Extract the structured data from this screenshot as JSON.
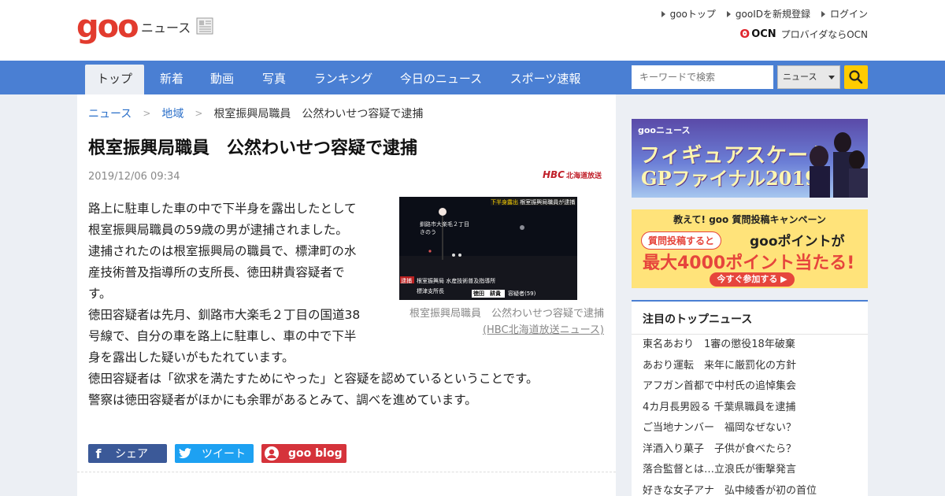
{
  "header": {
    "logo": "goo",
    "logo_sub": "ニュース",
    "top_links": [
      "gooトップ",
      "gooIDを新規登録",
      "ログイン"
    ],
    "ocn_brand": "OCN",
    "ocn_text": "プロバイダならOCN"
  },
  "nav": {
    "tabs": [
      "トップ",
      "新着",
      "動画",
      "写真",
      "ランキング",
      "今日のニュース",
      "スポーツ速報"
    ],
    "active": "トップ",
    "search_placeholder": "キーワードで検索",
    "search_scope": "ニュース"
  },
  "article": {
    "breadcrumb": [
      "ニュース",
      "地域",
      "根室振興局職員　公然わいせつ容疑で逮捕"
    ],
    "title": "根室振興局職員　公然わいせつ容疑で逮捕",
    "date": "2019/12/06 09:34",
    "source_logo": "HBC",
    "source_logo_sub": "北海道放送",
    "paragraphs": [
      "路上に駐車した車の中で下半身を露出したとして根室振興局職員の59歳の男が逮捕されました。",
      "逮捕されたのは根室振興局の職員で、標津町の水産技術普及指導所の支所長、徳田耕貴容疑者です。",
      "徳田容疑者は先月、釧路市大楽毛２丁目の国道38号線で、自分の車を路上に駐車し、車の中で下半身を露出した疑いがもたれています。",
      "徳田容疑者は「欲求を満たすためにやった」と容疑を認めているということです。",
      "警察は徳田容疑者がほかにも余罪があるとみて、調べを進めています。"
    ],
    "photo": {
      "overlay_top": "下半身露出",
      "overlay_top2": "根室振興局職員が逮捕",
      "overlay_place": "釧路市大楽毛２丁目",
      "overlay_place2": "きのう",
      "overlay_bottom_tag": "逮捕",
      "overlay_bottom1": "根室振興局 水産技術普及指導所",
      "overlay_bottom2": "標津支所長",
      "overlay_name": "徳田　耕貴",
      "overlay_age": "容疑者(59)"
    },
    "caption": "根室振興局職員　公然わいせつ容疑で逮捕",
    "caption_source": "(HBC北海道放送ニュース)",
    "share": {
      "facebook": "シェア",
      "twitter": "ツイート",
      "goo_blog": "goo blog"
    }
  },
  "sidebar": {
    "banner1": {
      "brand": "gooニュース",
      "line1": "フィギュアスケート",
      "line2": "GPファイナル2019"
    },
    "banner2": {
      "line1": "教えて! goo 質問投稿キャンペーン",
      "pill": "質問投稿すると",
      "line2": "gooポイントが",
      "line3": "最大4000ポイント当たる!",
      "cta": "今すぐ参加する ▶"
    },
    "top_news_title": "注目のトップニュース",
    "top_news": [
      "東名あおり　1審の懲役18年破棄",
      "あおり運転　来年に厳罰化の方針",
      "アフガン首都で中村氏の追悼集会",
      "4カ月長男殴る 千葉県職員を逮捕",
      "ご当地ナンバー　福岡なぜない？",
      "洋酒入り菓子　子供が食べたら？",
      "落合監督とは…立浪氏が衝撃発言",
      "好きな女子アナ　弘中綾香が初の首位"
    ]
  }
}
